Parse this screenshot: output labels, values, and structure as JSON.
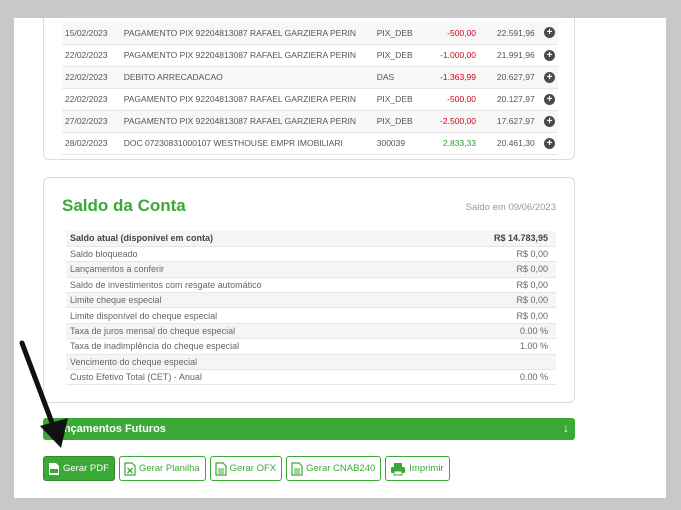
{
  "transactions": [
    {
      "date": "15/02/2023",
      "desc": "PAGAMENTO PIX 92204813087 RAFAEL GARZIERA PERIN",
      "type": "PIX_DEB",
      "value": "-500,00",
      "balance": "22.591,96",
      "sign": "neg"
    },
    {
      "date": "22/02/2023",
      "desc": "PAGAMENTO PIX 92204813087 RAFAEL GARZIERA PERIN",
      "type": "PIX_DEB",
      "value": "-1.000,00",
      "balance": "21.991,96",
      "sign": "neg"
    },
    {
      "date": "22/02/2023",
      "desc": "DEBITO ARRECADACAO",
      "type": "DAS",
      "value": "-1.363,99",
      "balance": "20.627,97",
      "sign": "neg"
    },
    {
      "date": "22/02/2023",
      "desc": "PAGAMENTO PIX 92204813087 RAFAEL GARZIERA PERIN",
      "type": "PIX_DEB",
      "value": "-500,00",
      "balance": "20.127,97",
      "sign": "neg"
    },
    {
      "date": "27/02/2023",
      "desc": "PAGAMENTO PIX 92204813087 RAFAEL GARZIERA PERIN",
      "type": "PIX_DEB",
      "value": "-2.500,00",
      "balance": "17.627,97",
      "sign": "neg"
    },
    {
      "date": "28/02/2023",
      "desc": "DOC 07230831000107 WESTHOUSE EMPR IMOBILIARI",
      "type": "300039",
      "value": "2.833,33",
      "balance": "20.461,30",
      "sign": "pos"
    }
  ],
  "saldo": {
    "title": "Saldo da Conta",
    "date_label": "Saldo em 09/06/2023",
    "rows": [
      {
        "label": "Saldo atual (disponível em conta)",
        "value": "R$ 14.783,95"
      },
      {
        "label": "Saldo bloqueado",
        "value": "R$ 0,00"
      },
      {
        "label": "Lançamentos a conferir",
        "value": "R$ 0,00"
      },
      {
        "label": "Saldo de investimentos com resgate automático",
        "value": "R$ 0,00"
      },
      {
        "label": "Limite cheque especial",
        "value": "R$ 0,00"
      },
      {
        "label": "Limite disponível do cheque especial",
        "value": "R$ 0,00"
      },
      {
        "label": "Taxa de juros mensal do cheque especial",
        "value": "0.00 %"
      },
      {
        "label": "Taxa de inadimplência do cheque especial",
        "value": "1.00 %"
      },
      {
        "label": "Vencimento do cheque especial",
        "value": ""
      },
      {
        "label": "Custo Efetivo Total (CET) - Anual",
        "value": "0.00 %"
      }
    ]
  },
  "futuros": {
    "label": "Lançamentos Futuros",
    "arrow": "↓"
  },
  "buttons": {
    "pdf": "Gerar PDF",
    "planilha": "Gerar Planilha",
    "ofx": "Gerar OFX",
    "cnab": "Gerar CNAB240",
    "imprimir": "Imprimir"
  },
  "icons": {
    "add": "plus-circle-icon",
    "pdf": "pdf-file-icon",
    "excel": "excel-file-icon",
    "file": "file-icon",
    "print": "printer-icon"
  },
  "colors": {
    "accent": "#3aa935",
    "negative": "#d0021b",
    "positive": "#2e9e2e"
  }
}
